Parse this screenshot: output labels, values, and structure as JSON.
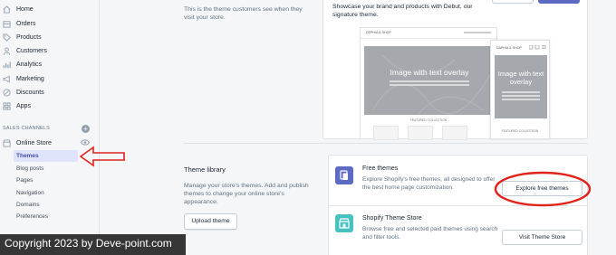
{
  "sidebar": {
    "items": [
      {
        "label": "Home",
        "icon": "home-icon"
      },
      {
        "label": "Orders",
        "icon": "orders-icon"
      },
      {
        "label": "Products",
        "icon": "tag-icon"
      },
      {
        "label": "Customers",
        "icon": "person-icon"
      },
      {
        "label": "Analytics",
        "icon": "bar-chart-icon"
      },
      {
        "label": "Marketing",
        "icon": "megaphone-icon"
      },
      {
        "label": "Discounts",
        "icon": "discount-icon"
      },
      {
        "label": "Apps",
        "icon": "apps-icon"
      }
    ],
    "sales_channels_heading": "SALES CHANNELS",
    "online_store": "Online Store",
    "sub_items": [
      "Themes",
      "Blog posts",
      "Pages",
      "Navigation",
      "Domains",
      "Preferences"
    ],
    "active_sub_item": "Themes"
  },
  "current_theme": {
    "description": "This is the theme customers see when they visit your store.",
    "card_description": "Showcase your brand and products with Debut, our signature theme.",
    "preview": {
      "desktop_logo": "DEPHIA & SHOP",
      "mobile_logo": "DAPHIA & SHOP",
      "hero_title": "Image with text overlay",
      "featured_label": "FEATURED COLLECTION"
    }
  },
  "theme_library": {
    "title": "Theme library",
    "description": "Manage your store's themes. Add and publish themes to change your online store's appearance.",
    "upload_button": "Upload theme",
    "free_themes": {
      "title": "Free themes",
      "description": "Explore Shopify's free themes, all designed to offer the best home page customization.",
      "button": "Explore free themes"
    },
    "theme_store": {
      "title": "Shopify Theme Store",
      "description": "Browse free and selected paid themes using search and filter tools.",
      "button": "Visit Theme Store"
    }
  },
  "watermark": "Copyright 2023 by Deve-point.com",
  "colors": {
    "accent": "#5c6ac4",
    "teal": "#47c1bf",
    "annotation_red": "#e0231b",
    "active_bg": "#dfe3fb"
  }
}
